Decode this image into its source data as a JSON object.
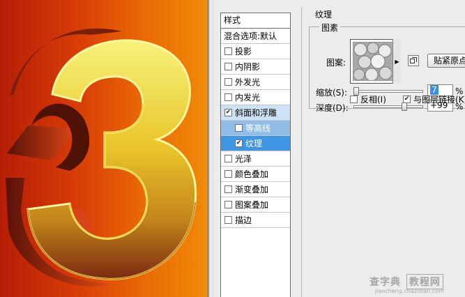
{
  "canvas": {
    "glyph": "3"
  },
  "style_list": {
    "header": "样式",
    "blend": "混合选项:默认",
    "items": [
      {
        "label": "投影",
        "checked": false
      },
      {
        "label": "内阴影",
        "checked": false
      },
      {
        "label": "外发光",
        "checked": false
      },
      {
        "label": "内发光",
        "checked": false
      },
      {
        "label": "斜面和浮雕",
        "checked": true
      },
      {
        "label": "等高线",
        "checked": false
      },
      {
        "label": "纹理",
        "checked": true
      },
      {
        "label": "光泽",
        "checked": false
      },
      {
        "label": "颜色叠加",
        "checked": false
      },
      {
        "label": "渐变叠加",
        "checked": false
      },
      {
        "label": "图案叠加",
        "checked": false
      },
      {
        "label": "描边",
        "checked": false
      }
    ]
  },
  "texture": {
    "section_title": "纹理",
    "group_title": "图素",
    "pattern_label": "图案:",
    "snap_origin_button": "贴紧原点",
    "scale": {
      "label": "缩放(S):",
      "value": "7",
      "unit": "%"
    },
    "depth": {
      "label": "深度(D):",
      "value": "+99",
      "unit": "%"
    },
    "invert": {
      "label": "反相(I)",
      "checked": false
    },
    "link": {
      "label": "与图层链接(K)",
      "checked": true
    }
  },
  "watermark": {
    "main_a": "查字典",
    "main_b": "教程网",
    "sub": "jiaocheng.chazidian.com"
  }
}
